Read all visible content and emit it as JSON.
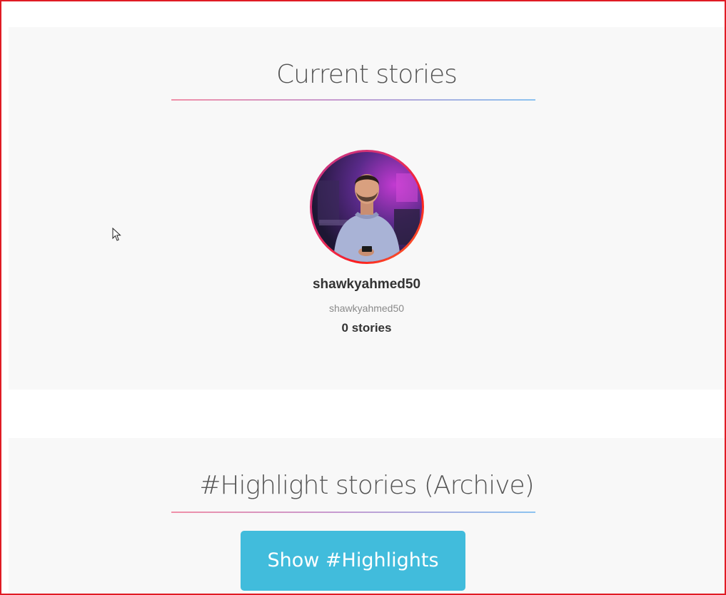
{
  "current_stories": {
    "title": "Current stories",
    "profile": {
      "display_name": "shawkyahmed50",
      "username": "shawkyahmed50",
      "stories_count": "0 stories"
    }
  },
  "highlight_stories": {
    "title": "#Highlight stories (Archive)",
    "show_button_label": "Show #Highlights"
  },
  "colors": {
    "accent_button": "#41bcdc",
    "frame_border": "#e01b24",
    "section_background": "#f8f8f8",
    "avatar_ring_start": "#c13584",
    "avatar_ring_end": "#f77737"
  },
  "icons": {
    "cursor": "mouse-pointer-icon"
  }
}
